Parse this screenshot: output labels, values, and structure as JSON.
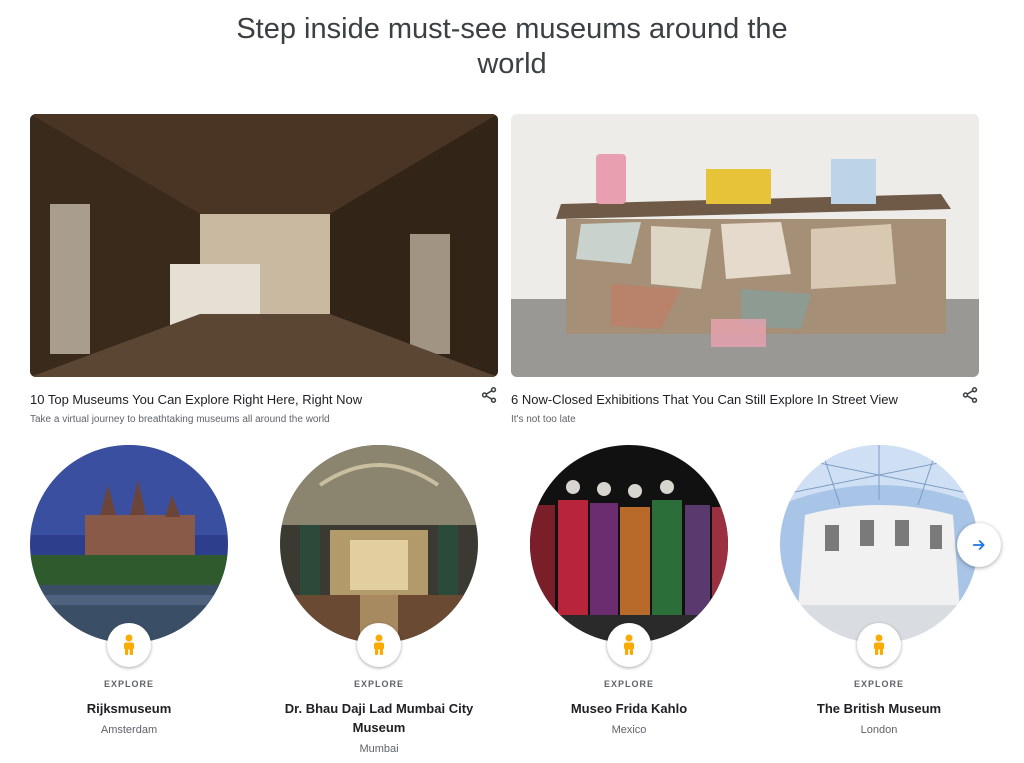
{
  "page": {
    "title_line1": "Step inside must-see museums around the",
    "title_line2": "world"
  },
  "featured": [
    {
      "title": "10 Top Museums You Can Explore Right Here, Right Now",
      "subtitle": "Take a virtual journey to breathtaking museums all around the world",
      "icon": "share-icon"
    },
    {
      "title": "6 Now-Closed Exhibitions That You Can Still Explore In Street View",
      "subtitle": "It's not too late",
      "icon": "share-icon"
    }
  ],
  "museums": [
    {
      "label": "EXPLORE",
      "name": "Rijksmuseum",
      "city": "Amsterdam",
      "icon": "pegman-icon"
    },
    {
      "label": "EXPLORE",
      "name": "Dr. Bhau Daji Lad Mumbai City Museum",
      "city": "Mumbai",
      "icon": "pegman-icon"
    },
    {
      "label": "EXPLORE",
      "name": "Museo Frida Kahlo",
      "city": "Mexico",
      "icon": "pegman-icon"
    },
    {
      "label": "EXPLORE",
      "name": "The British Museum",
      "city": "London",
      "icon": "pegman-icon"
    }
  ],
  "carousel": {
    "next_icon": "arrow-right-icon"
  },
  "colors": {
    "accent": "#1a73e8",
    "pegman": "#f9ab00",
    "text": "#202124",
    "muted": "#5f6368"
  }
}
